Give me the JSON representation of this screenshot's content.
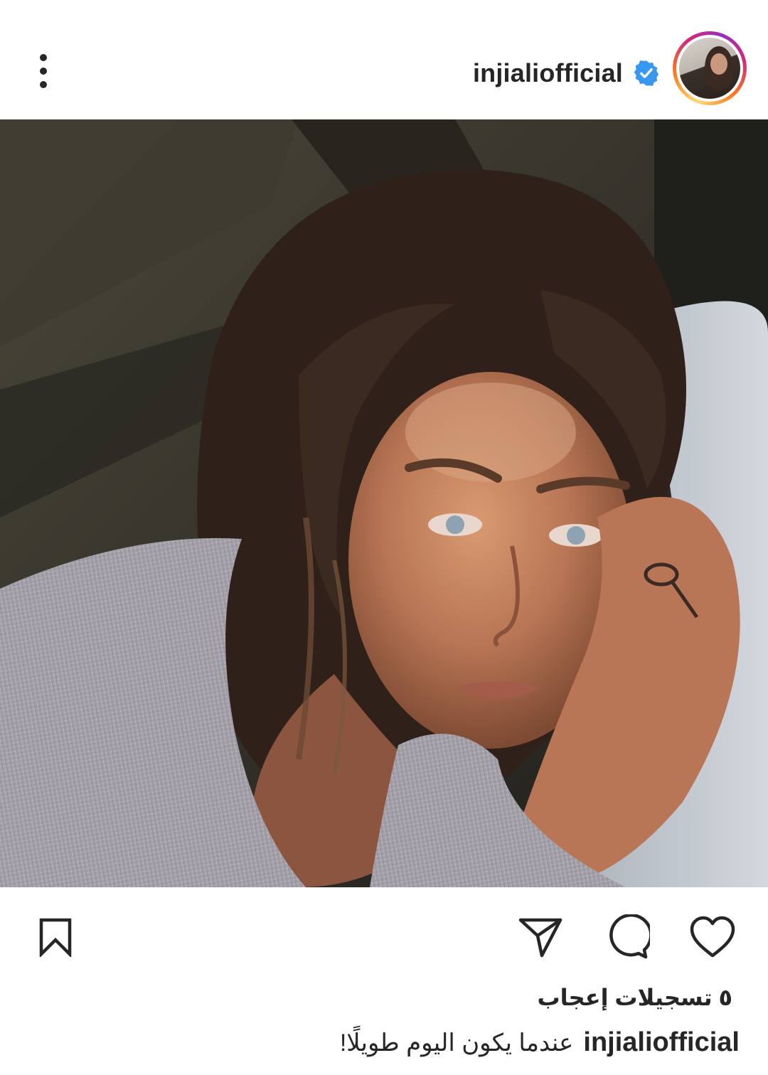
{
  "post": {
    "username": "injialiofficial",
    "verified": true,
    "likes_text": "٥ تسجيلات إعجاب",
    "caption_username": "injialiofficial",
    "caption_text": "عندما يكون اليوم طويلًا!"
  },
  "icons": {
    "more": "more-vertical-icon",
    "verified": "verified-badge-icon",
    "like": "heart-icon",
    "comment": "comment-bubble-icon",
    "share": "send-paper-plane-icon",
    "save": "bookmark-icon"
  },
  "colors": {
    "text": "#262626",
    "verified_blue": "#3897f0",
    "story_ring": [
      "#feda75",
      "#fa7e1e",
      "#d62976",
      "#962fbf"
    ]
  }
}
